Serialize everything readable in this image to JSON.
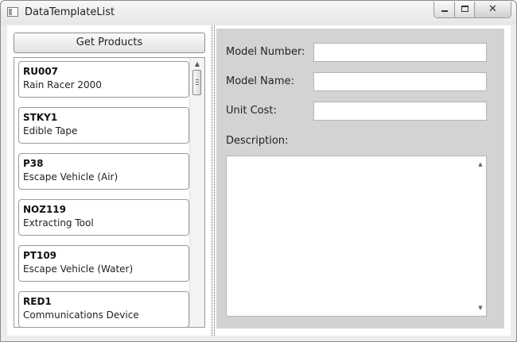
{
  "window": {
    "title": "DataTemplateList"
  },
  "left": {
    "get_products_label": "Get Products",
    "products": [
      {
        "code": "RU007",
        "name": "Rain Racer 2000"
      },
      {
        "code": "STKY1",
        "name": "Edible Tape"
      },
      {
        "code": "P38",
        "name": "Escape Vehicle (Air)"
      },
      {
        "code": "NOZ119",
        "name": "Extracting Tool"
      },
      {
        "code": "PT109",
        "name": "Escape Vehicle (Water)"
      },
      {
        "code": "RED1",
        "name": "Communications Device"
      }
    ]
  },
  "details": {
    "model_number_label": "Model Number:",
    "model_number_value": "",
    "model_name_label": "Model Name:",
    "model_name_value": "",
    "unit_cost_label": "Unit Cost:",
    "unit_cost_value": "",
    "description_label": "Description:",
    "description_value": ""
  },
  "icons": {
    "window_close": "✕",
    "scroll_up": "▲",
    "scroll_down": "▼"
  }
}
